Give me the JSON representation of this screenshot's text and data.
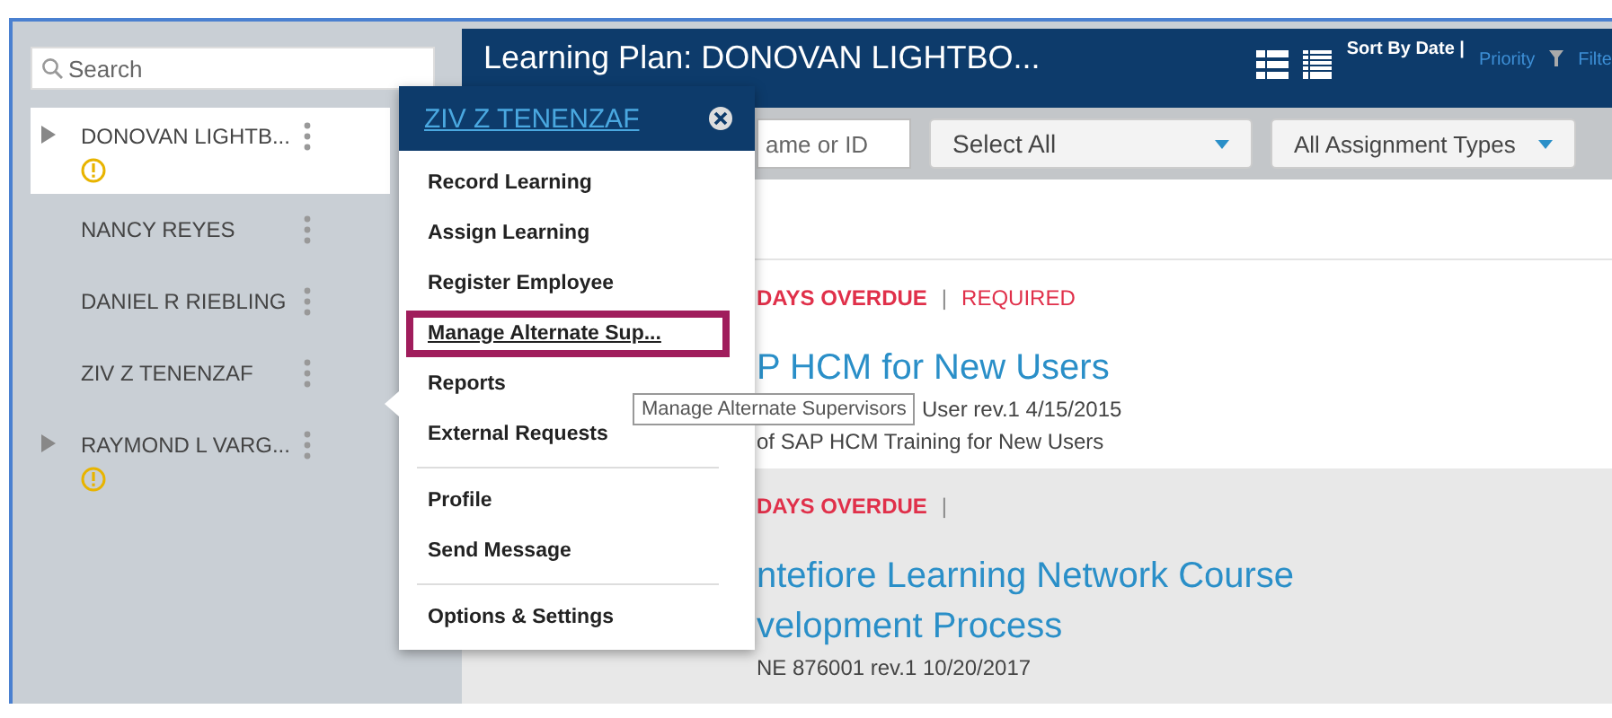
{
  "sidebar": {
    "search": {
      "placeholder": "Search"
    },
    "employees": [
      {
        "name": "DONOVAN LIGHTB...",
        "expandable": true,
        "warning": true,
        "selected": true
      },
      {
        "name": "NANCY REYES",
        "expandable": false,
        "warning": false,
        "selected": false
      },
      {
        "name": "DANIEL R RIEBLING",
        "expandable": false,
        "warning": false,
        "selected": false
      },
      {
        "name": "ZIV Z TENENZAF",
        "expandable": false,
        "warning": false,
        "selected": false
      },
      {
        "name": "RAYMOND L VARG...",
        "expandable": true,
        "warning": true,
        "selected": false
      }
    ]
  },
  "header": {
    "title": "Learning Plan: DONOVAN LIGHTBO...",
    "sort_label": "Sort By Date |",
    "sort_option": "Priority",
    "filter": "Filte"
  },
  "filters": {
    "search": {
      "placeholder": "ame or ID"
    },
    "dropdowns": [
      "Select All",
      "All Assignment Types"
    ]
  },
  "assignments": [
    {
      "status": "DAYS OVERDUE",
      "separator": "|",
      "tag": "REQUIRED",
      "title_lines": [
        "P HCM for New Users"
      ],
      "meta": "User rev.1 4/15/2015",
      "description": "of SAP HCM Training for New Users",
      "shaded": false
    },
    {
      "status": "DAYS OVERDUE",
      "separator": "|",
      "title_lines": [
        "ntefiore Learning Network Course",
        "velopment Process"
      ],
      "meta": "NE 876001 rev.1 10/20/2017",
      "shaded": true
    }
  ],
  "popup": {
    "title": "ZIV Z TENENZAF",
    "sections": [
      [
        {
          "label": "Record Learning",
          "highlighted": false
        },
        {
          "label": "Assign Learning",
          "highlighted": false
        },
        {
          "label": "Register Employee",
          "highlighted": false
        },
        {
          "label": "Manage Alternate Sup...",
          "highlighted": true
        },
        {
          "label": "Reports",
          "highlighted": false
        },
        {
          "label": "External Requests",
          "highlighted": false
        }
      ],
      [
        {
          "label": "Profile",
          "highlighted": false
        },
        {
          "label": "Send Message",
          "highlighted": false
        }
      ],
      [
        {
          "label": "Options & Settings",
          "highlighted": false
        }
      ]
    ]
  },
  "tooltip": "Manage Alternate Supervisors"
}
